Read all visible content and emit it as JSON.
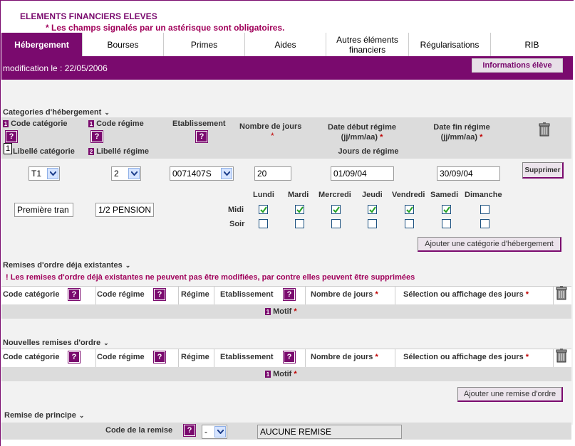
{
  "header": {
    "title": "ELEMENTS FINANCIERS ELEVES",
    "required_note": "* Les champs signalés par un astérisque sont obligatoires."
  },
  "tabs": [
    {
      "label": "Hébergement",
      "active": true
    },
    {
      "label": "Bourses"
    },
    {
      "label": "Primes"
    },
    {
      "label": "Aides"
    },
    {
      "label": "Autres éléments financiers"
    },
    {
      "label": "Régularisations"
    },
    {
      "label": "RIB"
    }
  ],
  "modification": "modification le : 22/05/2006",
  "info_button": "Informations élève",
  "hebergement": {
    "section_title": "Categories d'hébergement",
    "headers": {
      "code_categorie": "Code catégorie",
      "code_regime": "Code régime",
      "etablissement": "Etablissement",
      "nombre_jours": "Nombre de jours",
      "date_debut": "Date début régime (jj/mm/aa)",
      "date_fin": "Date fin régime (jj/mm/aa)",
      "libelle_categorie": "Libellé catégorie",
      "libelle_regime": "Libellé régime",
      "jours_regime": "Jours de régime"
    },
    "row": {
      "code_categorie": "T1",
      "code_regime": "2",
      "etablissement": "0071407S",
      "nombre_jours": "20",
      "date_debut": "01/09/04",
      "date_fin": "30/09/04",
      "libelle_categorie": "Première tran",
      "libelle_regime": "1/2 PENSION"
    },
    "delete_button": "Supprimer",
    "days": [
      "Lundi",
      "Mardi",
      "Mercredi",
      "Jeudi",
      "Vendredi",
      "Samedi",
      "Dimanche"
    ],
    "midi_label": "Midi",
    "soir_label": "Soir",
    "midi_checked": [
      true,
      true,
      true,
      true,
      true,
      true,
      false
    ],
    "soir_checked": [
      false,
      false,
      false,
      false,
      false,
      false,
      false
    ],
    "add_button": "Ajouter une catégorie d'hébergement",
    "tooltip_number": "1"
  },
  "remises_existantes": {
    "section_title": "Remises d'ordre déja existantes",
    "warning": "! Les remises d'ordre déjà existantes ne peuvent pas être modifiées, par contre elles peuvent être supprimées"
  },
  "remises_headers": {
    "code_categorie": "Code catégorie",
    "code_regime": "Code régime",
    "regime": "Régime",
    "etablissement": "Etablissement",
    "nombre_jours": "Nombre de jours",
    "selection_jours": "Sélection ou affichage des jours",
    "motif": "Motif"
  },
  "nouvelles_remises": {
    "section_title": "Nouvelles remises d'ordre",
    "add_button": "Ajouter une remise d'ordre"
  },
  "remise_principe": {
    "section_title": "Remise de principe",
    "code_label": "Code de la remise",
    "code_value": "-",
    "remise_value": "AUCUNE REMISE"
  },
  "colors": {
    "brand": "#7a0a6e",
    "warning": "#a0005a"
  }
}
